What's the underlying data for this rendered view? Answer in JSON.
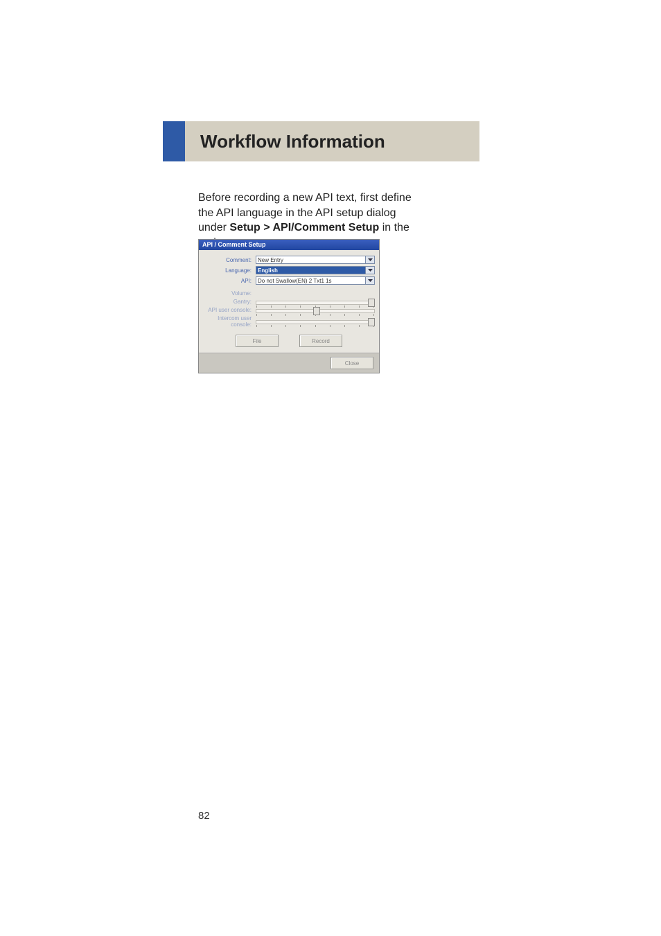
{
  "header": {
    "title": "Workflow Information"
  },
  "para": {
    "before": "Before recording a new API text, first define the API language in the API setup dialog under ",
    "bold": "Setup >  API/Comment Setup",
    "after": " in the main menu."
  },
  "screenshot": {
    "title": "API / Comment Setup",
    "rows": {
      "comment": {
        "label": "Comment:",
        "value": "New Entry"
      },
      "language": {
        "label": "Language:",
        "value": "English"
      },
      "api": {
        "label": "API:",
        "value": "Do not Swallow(EN) 2 Txt1 1s"
      },
      "volume": {
        "label": "Volume:"
      },
      "gantry": {
        "label": "Gantry:"
      },
      "api_user_console": {
        "label": "API user console:"
      },
      "intercom_user_console": {
        "label": "Intercom user console:"
      }
    },
    "buttons": {
      "file": "File",
      "record": "Record",
      "close": "Close"
    }
  },
  "page_number": "82"
}
